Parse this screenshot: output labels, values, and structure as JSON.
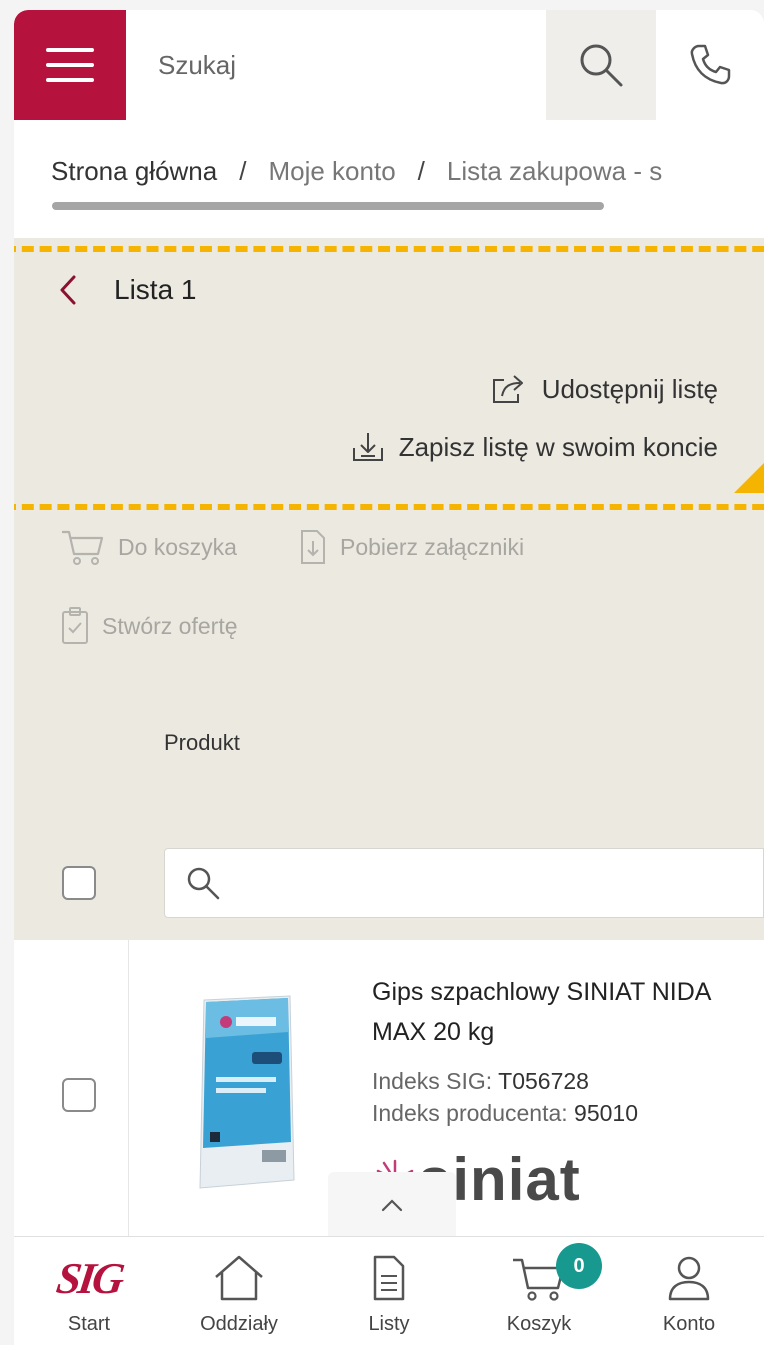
{
  "header": {
    "search_placeholder": "Szukaj",
    "icons": {
      "menu": "hamburger-icon",
      "search": "search-icon",
      "phone": "phone-icon"
    },
    "accent_color": "#b5123e"
  },
  "breadcrumb": {
    "items": [
      "Strona główna",
      "Moje konto",
      "Lista zakupowa - s"
    ],
    "separator": "/"
  },
  "list": {
    "title": "Lista 1",
    "share_label": "Udostępnij listę",
    "save_label": "Zapisz listę w swoim koncie"
  },
  "actions": {
    "to_cart": "Do koszyka",
    "download_attachments": "Pobierz załączniki",
    "create_offer": "Stwórz ofertę"
  },
  "table": {
    "product_header": "Produkt",
    "filter_placeholder": ""
  },
  "product": {
    "name": "Gips szpachlowy SINIAT NIDA MAX 20 kg",
    "sig_index_label": "Indeks SIG:",
    "sig_index": "T056728",
    "producer_index_label": "Indeks producenta:",
    "producer_index": "95010",
    "brand": "siniat"
  },
  "bottom_nav": {
    "start": "Start",
    "branches": "Oddziały",
    "lists": "Listy",
    "cart": "Koszyk",
    "cart_count": "0",
    "account": "Konto",
    "logo_text": "SIG",
    "badge_color": "#17998f"
  },
  "highlight_color": "#f4b400"
}
